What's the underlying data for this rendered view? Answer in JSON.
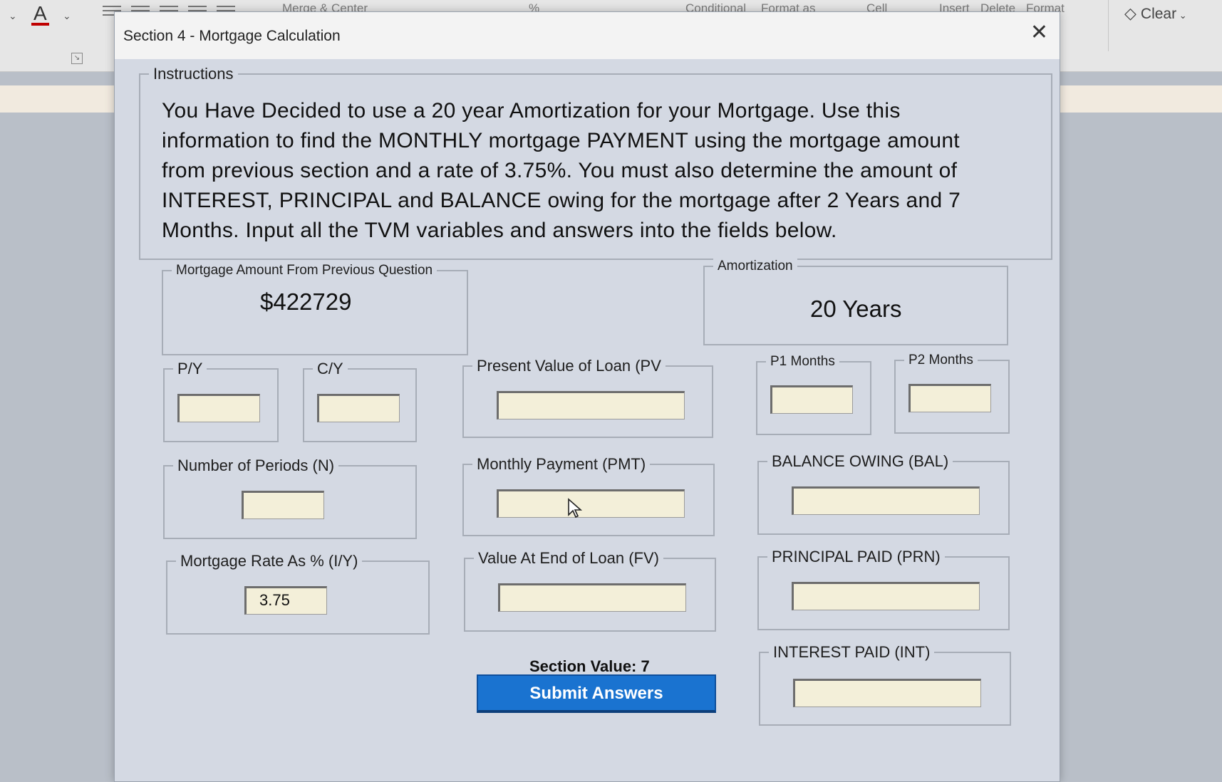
{
  "ribbon": {
    "font_color_letter": "A",
    "merge_center": "Merge & Center",
    "percent": "%",
    "conditional": "Conditional",
    "format_as": "Format as",
    "cell": "Cell",
    "insert": "Insert",
    "delete": "Delete",
    "format": "Format",
    "clear_label": "Clear"
  },
  "dialog": {
    "title": "Section 4 - Mortgage Calculation",
    "instructions_label": "Instructions",
    "instructions_text": "You Have Decided to use a 20 year Amortization for your Mortgage. Use this information to find the MONTHLY mortgage PAYMENT using the mortgage amount from previous section and a rate of 3.75%. You must also determine the amount of INTEREST, PRINCIPAL and BALANCE owing for the mortgage after 2 Years and 7 Months. Input all the TVM variables and answers into the fields below.",
    "mortgage_amount_label": "Mortgage Amount From Previous Question",
    "mortgage_amount_value": "$422729",
    "amortization_label": "Amortization",
    "amortization_value": "20 Years",
    "py_label": "P/Y",
    "cy_label": "C/Y",
    "pv_label": "Present Value of Loan (PV",
    "p1_label": "P1 Months",
    "p2_label": "P2 Months",
    "n_label": "Number of Periods (N)",
    "pmt_label": "Monthly Payment (PMT)",
    "bal_label": "BALANCE OWING (BAL)",
    "iy_label": "Mortgage Rate As % (I/Y)",
    "iy_value": "3.75",
    "fv_label": "Value At End of Loan (FV)",
    "prn_label": "PRINCIPAL PAID  (PRN)",
    "int_label": "INTEREST PAID  (INT)",
    "section_value": "Section Value: 7",
    "submit_label": "Submit Answers"
  }
}
